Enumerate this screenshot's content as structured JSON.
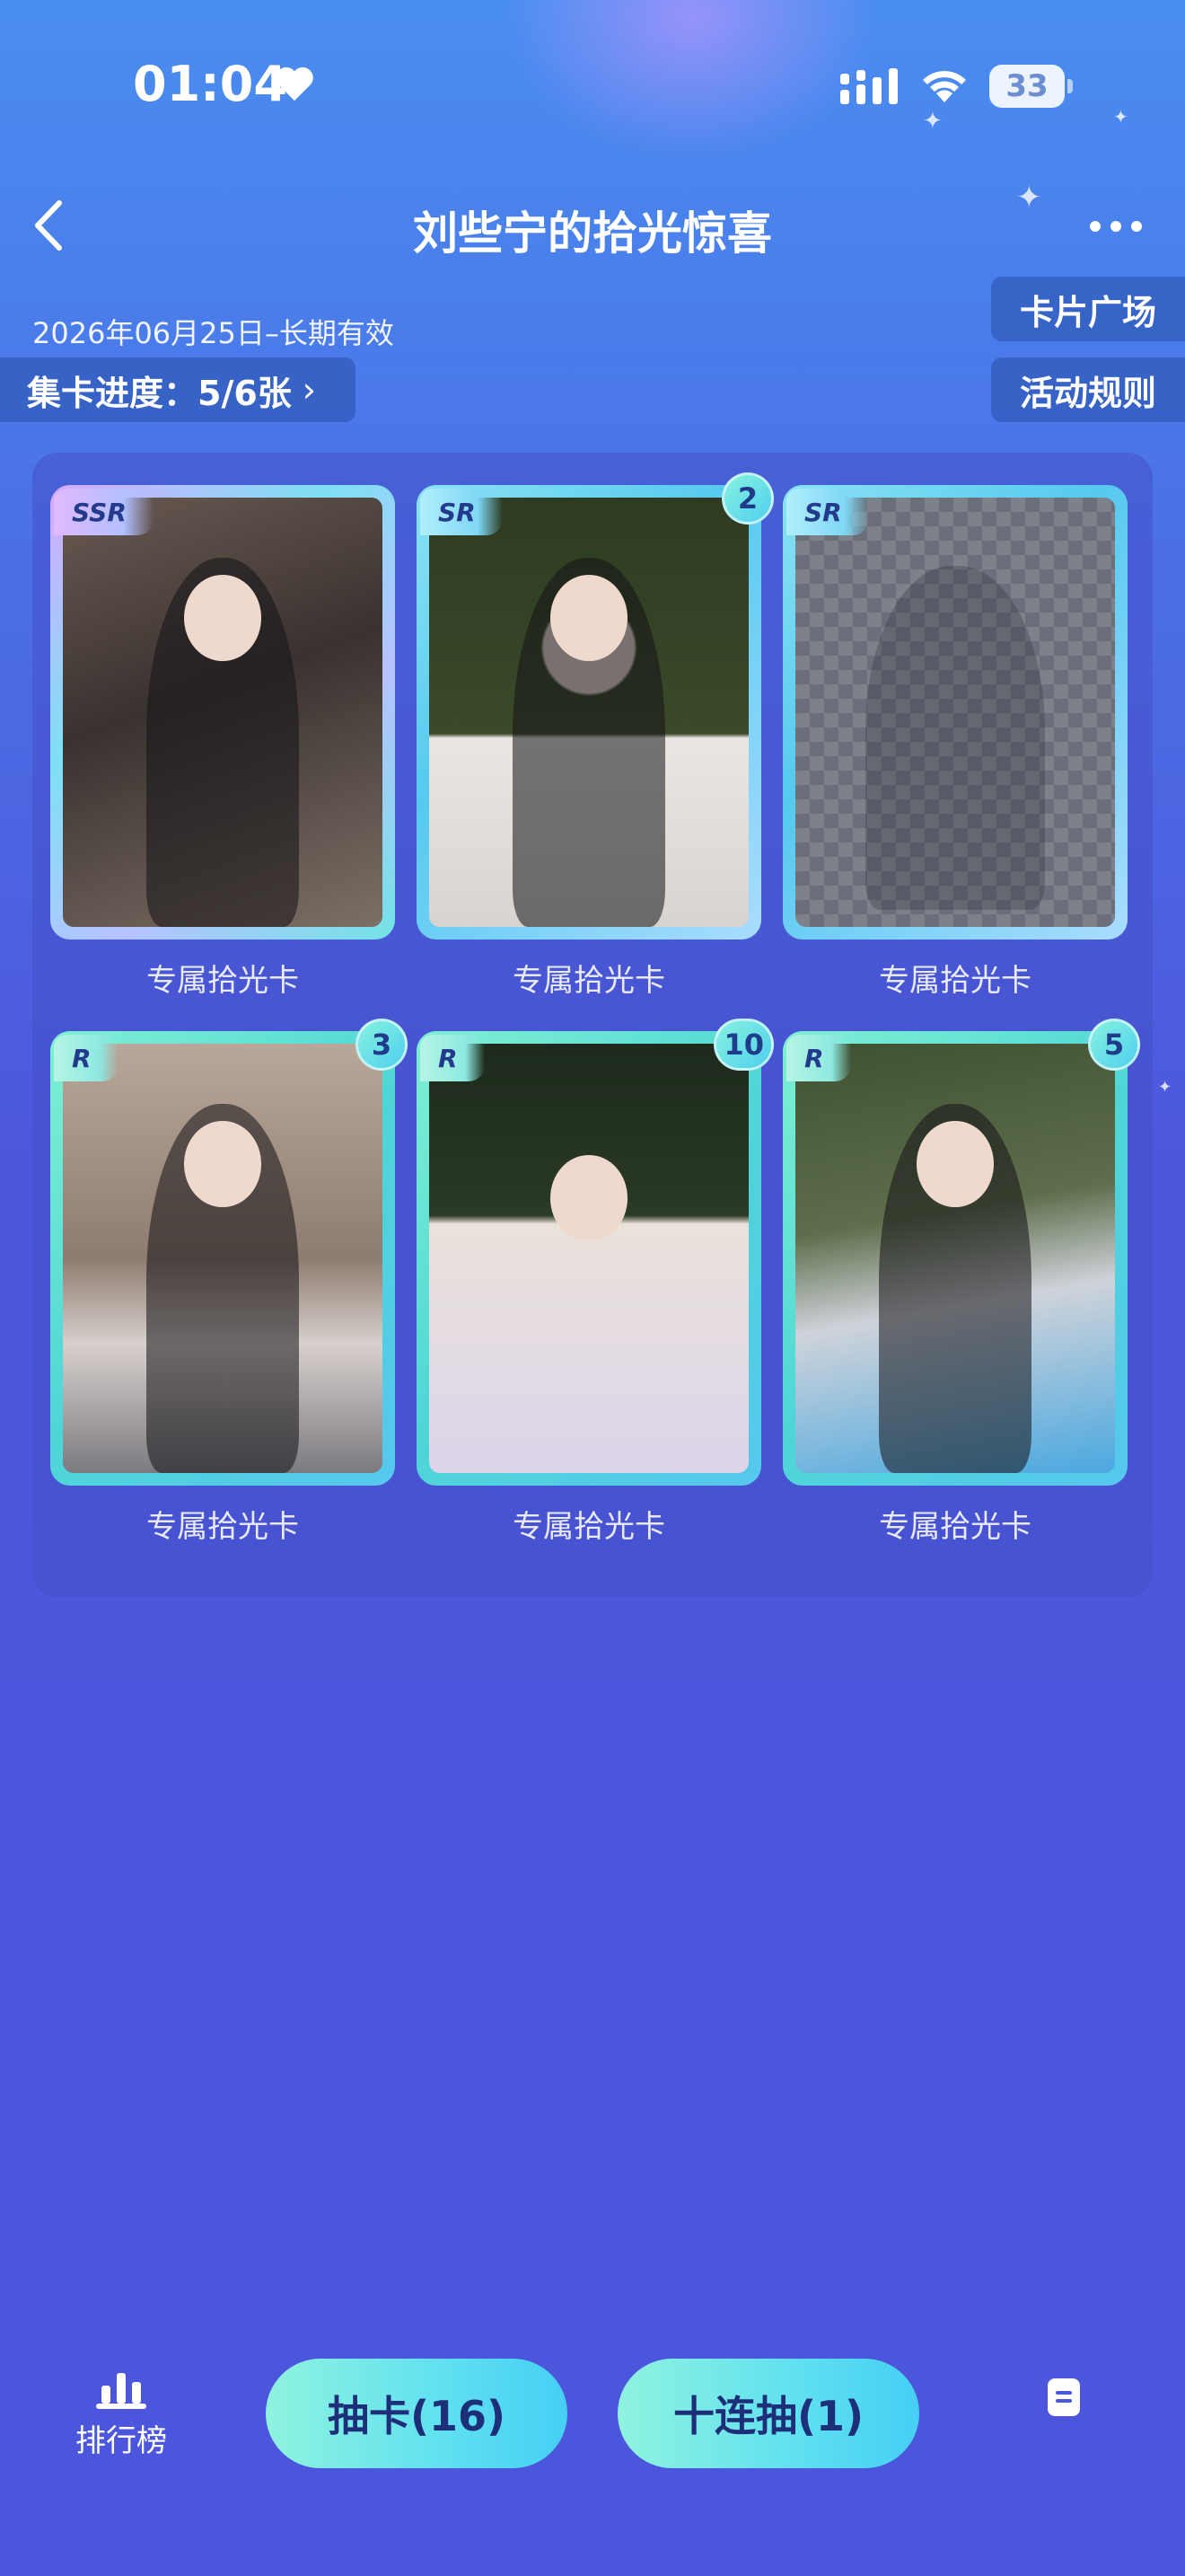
{
  "status_bar": {
    "time": "01:04",
    "battery": "33"
  },
  "header": {
    "title": "刘些宁的拾光惊喜"
  },
  "info": {
    "validity": "2026年06月25日–长期有效",
    "progress_label": "集卡进度：5/6张",
    "progress_chevron": "›",
    "card_plaza": "卡片广场",
    "activity_rules": "活动规则"
  },
  "cards": [
    {
      "rarity": "SSR",
      "count": "",
      "label": "专属拾光卡",
      "collected": true
    },
    {
      "rarity": "SR",
      "count": "2",
      "label": "专属拾光卡",
      "collected": true
    },
    {
      "rarity": "SR",
      "count": "",
      "label": "专属拾光卡",
      "collected": false
    },
    {
      "rarity": "R",
      "count": "3",
      "label": "专属拾光卡",
      "collected": true
    },
    {
      "rarity": "R",
      "count": "10",
      "label": "专属拾光卡",
      "collected": true
    },
    {
      "rarity": "R",
      "count": "5",
      "label": "专属拾光卡",
      "collected": true
    }
  ],
  "bottom_bar": {
    "ranking_label": "排行榜",
    "draw_label": "抽卡(16)",
    "draw_ten_label": "十连抽(1)",
    "icons": [
      "bar-chart-icon",
      "note-icon"
    ]
  },
  "colors": {
    "accent": "#5fe0f1",
    "button_text": "#1e2f7a",
    "background": "#4c56dd"
  }
}
